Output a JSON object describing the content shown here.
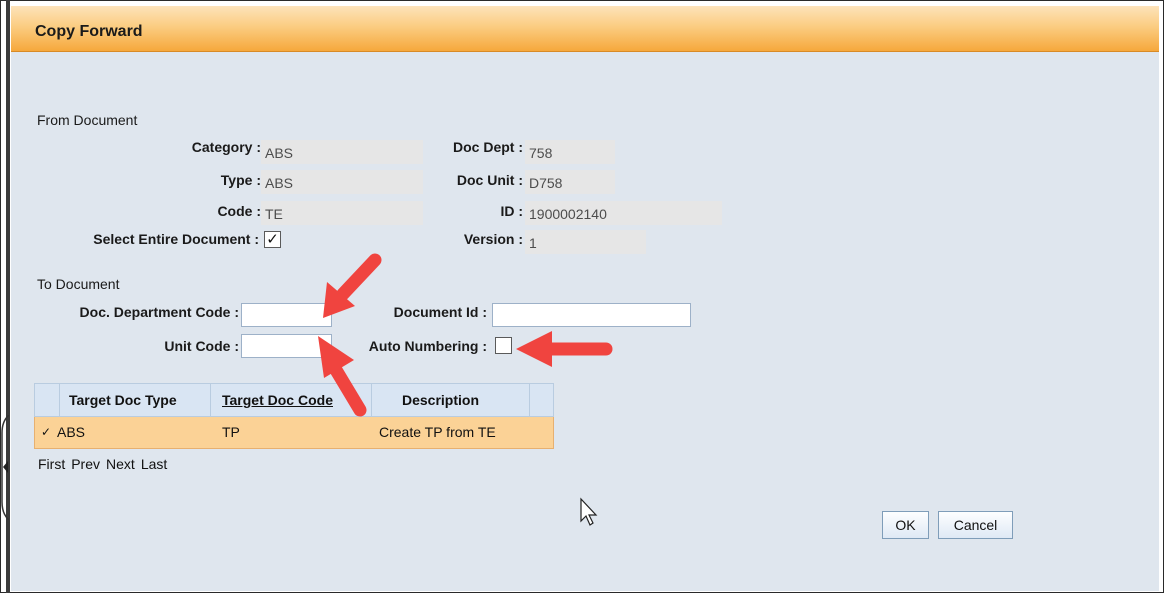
{
  "dialog": {
    "title": "Copy Forward"
  },
  "from_document": {
    "section_label": "From Document",
    "category_label": "Category :",
    "category_value": "ABS",
    "type_label": "Type :",
    "type_value": "ABS",
    "code_label": "Code :",
    "code_value": "TE",
    "select_entire_label": "Select Entire Document :",
    "select_entire_checked": true,
    "check_mark": "✓",
    "doc_dept_label": "Doc Dept :",
    "doc_dept_value": "758",
    "doc_unit_label": "Doc Unit :",
    "doc_unit_value": "D758",
    "id_label": "ID :",
    "id_value": "1900002140",
    "version_label": "Version :",
    "version_value": "1"
  },
  "to_document": {
    "section_label": "To Document",
    "dept_code_label": "Doc. Department Code :",
    "dept_code_value": "",
    "unit_code_label": "Unit Code :",
    "unit_code_value": "",
    "document_id_label": "Document Id :",
    "document_id_value": "",
    "auto_numbering_label": "Auto Numbering :",
    "auto_numbering_checked": false
  },
  "table": {
    "headers": [
      "Target Doc Type",
      "Target Doc Code",
      "Description"
    ],
    "rows": [
      {
        "check": "✓",
        "doc_type": "ABS",
        "doc_code": "TP",
        "description": "Create TP from TE"
      }
    ]
  },
  "pager": {
    "first": "First",
    "prev": "Prev",
    "next": "Next",
    "last": "Last"
  },
  "buttons": {
    "ok": "OK",
    "cancel": "Cancel"
  },
  "colors": {
    "title_bar": "#f9bd6a",
    "dialog_bg": "#dfe6ee",
    "selected_row": "#fbd296",
    "annotation_arrow": "#f0443f"
  },
  "icons": {
    "cursor": "mouse-pointer-icon",
    "annotations": "red-arrow-icon"
  }
}
